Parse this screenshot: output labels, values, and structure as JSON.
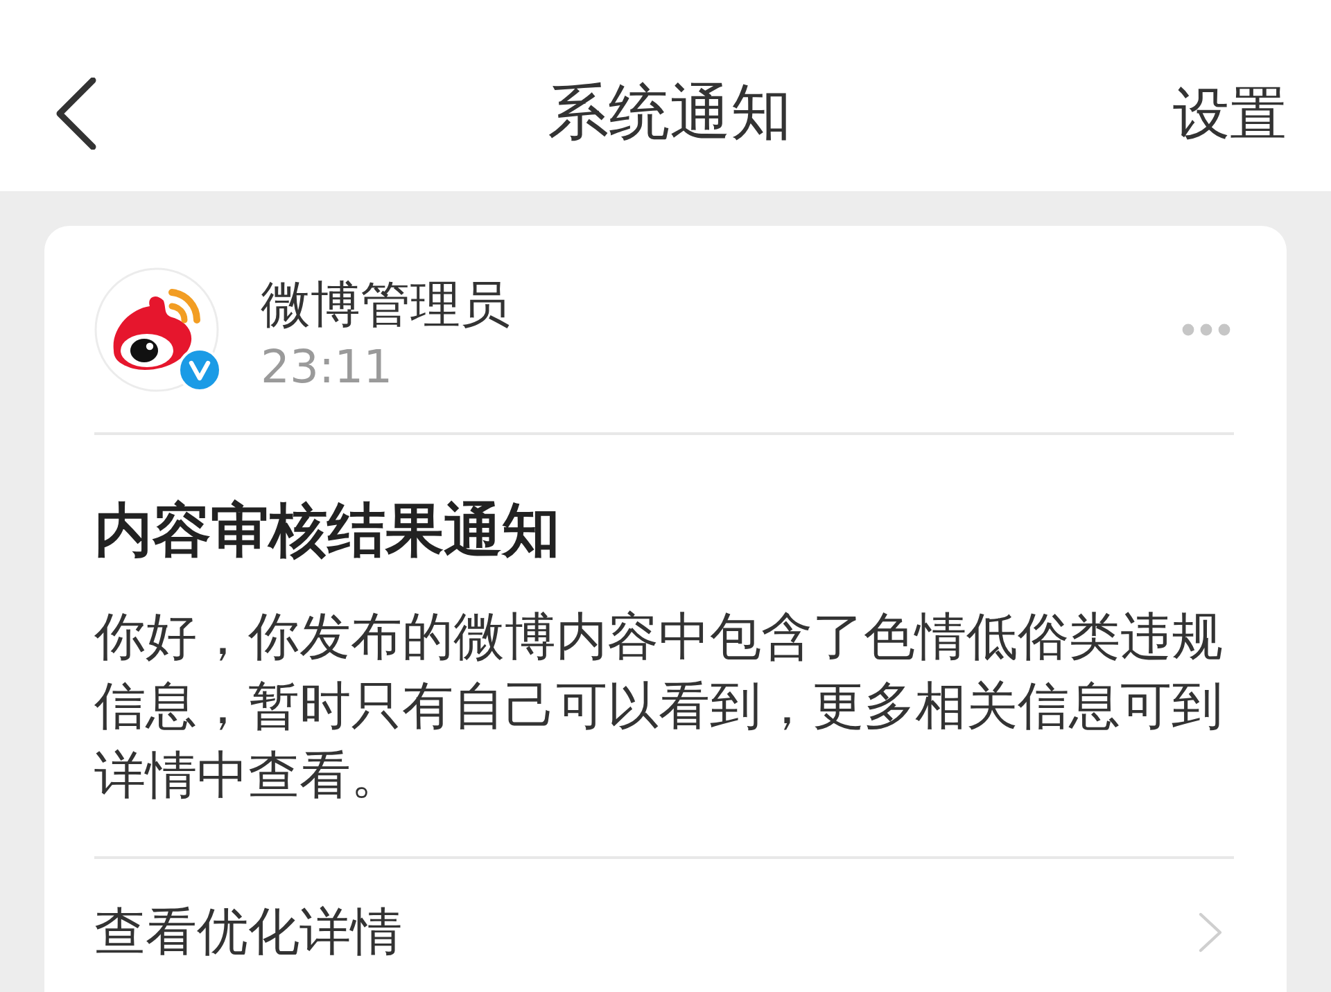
{
  "header": {
    "title": "系统通知",
    "action": "设置"
  },
  "notice": {
    "sender": {
      "name": "微博管理员",
      "verified": true
    },
    "time": "23:11",
    "title": "内容审核结果通知",
    "body": "你好，你发布的微博内容中包含了色情低俗类违规信息，暂时只有自己可以看到，更多相关信息可到详情中查看。",
    "link": "查看优化详情"
  }
}
